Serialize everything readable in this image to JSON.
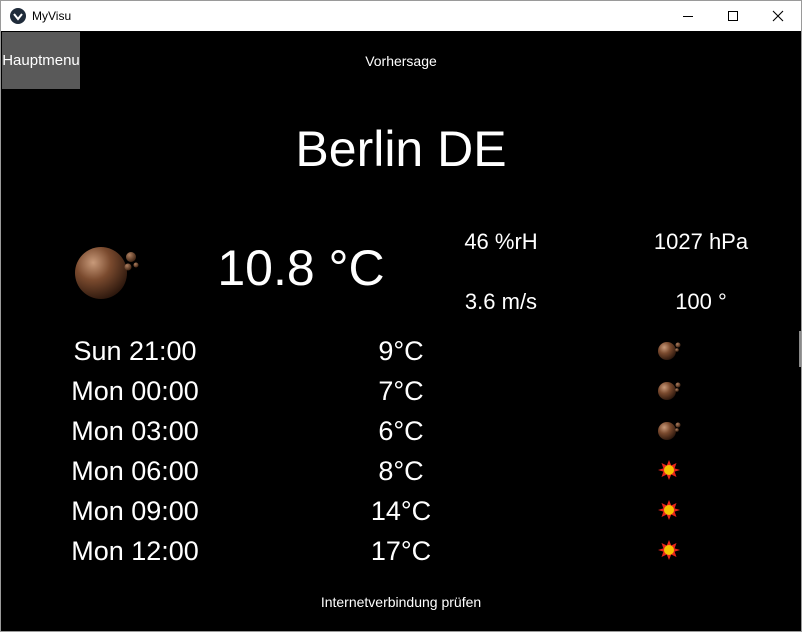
{
  "window": {
    "title": "MyVisu"
  },
  "header": {
    "menu_button": "Hauptmenu",
    "page_title": "Vorhersage"
  },
  "current": {
    "city": "Berlin DE",
    "temperature": "10.8 °C",
    "humidity": "46 %rH",
    "pressure": "1027 hPa",
    "wind_speed": "3.6 m/s",
    "wind_direction": "100 °",
    "icon": "moon-cloud-icon"
  },
  "forecast": [
    {
      "time": "Sun 21:00",
      "temp": "9°C",
      "icon": "moon-cloud-icon"
    },
    {
      "time": "Mon 00:00",
      "temp": "7°C",
      "icon": "moon-cloud-icon"
    },
    {
      "time": "Mon 03:00",
      "temp": "6°C",
      "icon": "moon-cloud-icon"
    },
    {
      "time": "Mon 06:00",
      "temp": "8°C",
      "icon": "sun-icon"
    },
    {
      "time": "Mon 09:00",
      "temp": "14°C",
      "icon": "sun-icon"
    },
    {
      "time": "Mon 12:00",
      "temp": "17°C",
      "icon": "sun-icon"
    }
  ],
  "footer": {
    "status": "Internetverbindung prüfen"
  },
  "colors": {
    "background": "#000000",
    "button": "#595959",
    "text": "#ffffff",
    "moon": "#7a4a2e",
    "sun": "#e8251a"
  }
}
